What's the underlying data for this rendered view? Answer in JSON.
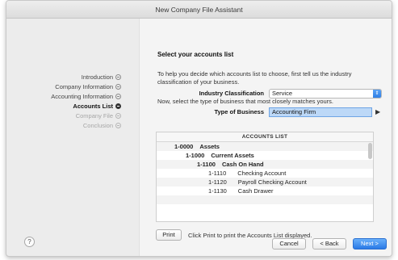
{
  "window": {
    "title": "New Company File Assistant"
  },
  "sidebar": {
    "steps": [
      {
        "label": "Introduction",
        "state": "done"
      },
      {
        "label": "Company Information",
        "state": "done"
      },
      {
        "label": "Accounting Information",
        "state": "done"
      },
      {
        "label": "Accounts List",
        "state": "active"
      },
      {
        "label": "Company File",
        "state": "disabled"
      },
      {
        "label": "Conclusion",
        "state": "disabled"
      }
    ],
    "help_label": "?"
  },
  "main": {
    "heading": "Select your accounts list",
    "intro": "To help you decide which accounts list to choose, first tell us the industry classification of your business.",
    "industry_label": "Industry Classification",
    "industry_value": "Service",
    "type_prompt": "Now, select the type of business that most closely matches yours.",
    "type_label": "Type of Business",
    "type_value": "Accounting Firm",
    "accounts_list": {
      "header": "ACCOUNTS LIST",
      "rows": [
        {
          "number": "1-0000",
          "name": "Assets",
          "level": 0,
          "bold": true
        },
        {
          "number": "1-1000",
          "name": "Current Assets",
          "level": 1,
          "bold": true
        },
        {
          "number": "1-1100",
          "name": "Cash On Hand",
          "level": 2,
          "bold": true
        },
        {
          "number": "1-1110",
          "name": "Checking Account",
          "level": 3,
          "bold": false
        },
        {
          "number": "1-1120",
          "name": "Payroll Checking Account",
          "level": 3,
          "bold": false
        },
        {
          "number": "1-1130",
          "name": "Cash Drawer",
          "level": 3,
          "bold": false
        }
      ]
    },
    "print_button": "Print",
    "print_note": "Click Print to print the Accounts List displayed."
  },
  "footer": {
    "cancel": "Cancel",
    "back": "< Back",
    "next": "Next >"
  },
  "colors": {
    "accent": "#2f7fe6",
    "selection": "#bcd8f7"
  }
}
